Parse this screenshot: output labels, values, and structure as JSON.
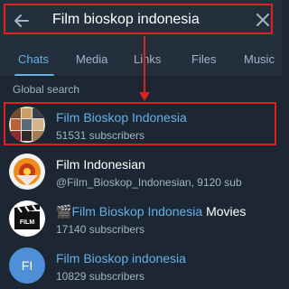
{
  "search": {
    "query": "Film bioskop indonesia"
  },
  "tabs": [
    {
      "label": "Chats",
      "active": true
    },
    {
      "label": "Media",
      "active": false
    },
    {
      "label": "Links",
      "active": false
    },
    {
      "label": "Files",
      "active": false
    },
    {
      "label": "Music",
      "active": false
    }
  ],
  "section_label": "Global search",
  "results": [
    {
      "title_highlight": "Film Bioskop Indonesia",
      "title_rest": "",
      "subtitle": "51531 subscribers",
      "avatar_icon": "photo-collage-avatar"
    },
    {
      "title_highlight": "",
      "title_rest": "Film Indonesian",
      "subtitle": "@Film_Bioskop_Indonesian, 9120 sub",
      "avatar_icon": "film-reel-avatar"
    },
    {
      "title_prefix": "🎬",
      "title_highlight": "Film Bioskop Indonesia",
      "title_rest": " Movies",
      "subtitle": "17140 subscribers",
      "avatar_icon": "clapperboard-avatar"
    },
    {
      "title_highlight": "Film Bioskop indonesia",
      "title_rest": "",
      "subtitle": "10829 subscribers",
      "avatar_initials": "FI",
      "avatar_icon": "initials-avatar"
    }
  ],
  "colors": {
    "background": "#1c2733",
    "header": "#232f3d",
    "accent": "#64b0e8",
    "annotation": "#e0201a",
    "avatar_initials_bg": "#4f8fd8"
  }
}
